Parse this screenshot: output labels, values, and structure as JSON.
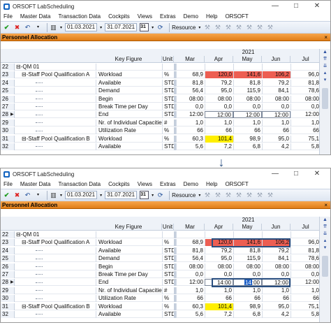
{
  "window": {
    "title": "ORSOFT LabScheduling",
    "controls": [
      "—",
      "□",
      "✕"
    ]
  },
  "menu": [
    "File",
    "Master Data",
    "Transaction Data",
    "Cockpits",
    "Views",
    "Extras",
    "Demo",
    "Help",
    "ORSOFT"
  ],
  "toolbar": {
    "date_from": "01.03.2021",
    "date_to": "31.07.2021",
    "calendar_label": "31",
    "dropdown_label": "Resource"
  },
  "panel": {
    "title": "Personnel Allocation",
    "close": "×"
  },
  "grid": {
    "year": "2021",
    "col_key_figure": "Key Figure",
    "col_unit": "Unit",
    "months": [
      "Mar",
      "Apr",
      "May",
      "Jun",
      "Jul"
    ],
    "rows_before": [
      {
        "n": "22",
        "tree": "⊟-QM 01",
        "kf": "",
        "unit": "",
        "vals": [
          "",
          "",
          "",
          "",
          ""
        ]
      },
      {
        "n": "23",
        "tree": "⊟-Staff Pool Qualification A",
        "kf": "Workload",
        "unit": "%",
        "vals": [
          "68,9",
          "120,0",
          "141,6",
          "106,2",
          "96,0"
        ]
      },
      {
        "n": "24",
        "tree": "",
        "kf": "Available",
        "unit": "STD",
        "vals": [
          "81,8",
          "79,2",
          "81,8",
          "79,2",
          "81,8"
        ]
      },
      {
        "n": "25",
        "tree": "",
        "kf": "Demand",
        "unit": "STD",
        "vals": [
          "56,4",
          "95,0",
          "115,9",
          "84,1",
          "78,6"
        ]
      },
      {
        "n": "26",
        "tree": "",
        "kf": "Begin",
        "unit": "STD",
        "vals": [
          "08:00",
          "08:00",
          "08:00",
          "08:00",
          "08:00"
        ]
      },
      {
        "n": "27",
        "tree": "",
        "kf": "Break Time per Day",
        "unit": "STD",
        "vals": [
          "0,0",
          "0,0",
          "0,0",
          "0,0",
          "0,0"
        ]
      },
      {
        "n": "28",
        "tree": "",
        "kf": "End",
        "unit": "STD",
        "vals": [
          "12:00",
          "12:00",
          "12:00",
          "12:00",
          "12:00"
        ]
      },
      {
        "n": "29",
        "tree": "",
        "kf": "Nr. of Individual Capacities",
        "unit": "#",
        "vals": [
          "1,0",
          "1,0",
          "1,0",
          "1,0",
          "1,0"
        ]
      },
      {
        "n": "30",
        "tree": "",
        "kf": "Utilization Rate",
        "unit": "%",
        "vals": [
          "66",
          "66",
          "66",
          "66",
          "66"
        ]
      },
      {
        "n": "31",
        "tree": "⊟-Staff Pool Qualification B",
        "kf": "Workload",
        "unit": "%",
        "vals": [
          "60,3",
          "101,4",
          "98,9",
          "95,0",
          "75,1"
        ]
      },
      {
        "n": "32",
        "tree": "",
        "kf": "Available",
        "unit": "STD",
        "vals": [
          "5,6",
          "7,2",
          "6,8",
          "4,2",
          "5,8"
        ]
      }
    ],
    "rows_after": [
      {
        "n": "22",
        "tree": "⊟-QM 01",
        "kf": "",
        "unit": "",
        "vals": [
          "",
          "",
          "",
          "",
          ""
        ]
      },
      {
        "n": "23",
        "tree": "⊟-Staff Pool Qualification A",
        "kf": "Workload",
        "unit": "%",
        "vals": [
          "68,9",
          "120,0",
          "141,6",
          "106,2",
          "96,0"
        ]
      },
      {
        "n": "24",
        "tree": "",
        "kf": "Available",
        "unit": "STD",
        "vals": [
          "81,8",
          "79,2",
          "81,8",
          "79,2",
          "81,8"
        ]
      },
      {
        "n": "25",
        "tree": "",
        "kf": "Demand",
        "unit": "STD",
        "vals": [
          "56,4",
          "95,0",
          "115,9",
          "84,1",
          "78,6"
        ]
      },
      {
        "n": "26",
        "tree": "",
        "kf": "Begin",
        "unit": "STD",
        "vals": [
          "08:00",
          "08:00",
          "08:00",
          "08:00",
          "08:00"
        ]
      },
      {
        "n": "27",
        "tree": "",
        "kf": "Break Time per Day",
        "unit": "STD",
        "vals": [
          "0,0",
          "0,0",
          "0,0",
          "0,0",
          "0,0"
        ]
      },
      {
        "n": "28",
        "tree": "",
        "kf": "End",
        "unit": "STD",
        "vals": [
          "12:00",
          "14:00",
          "14:00",
          "12:00",
          "12:00"
        ]
      },
      {
        "n": "29",
        "tree": "",
        "kf": "Nr. of Individual Capacities",
        "unit": "#",
        "vals": [
          "1,0",
          "1,0",
          "1,0",
          "1,0",
          "1,0"
        ]
      },
      {
        "n": "30",
        "tree": "",
        "kf": "Utilization Rate",
        "unit": "%",
        "vals": [
          "66",
          "66",
          "66",
          "66",
          "66"
        ]
      },
      {
        "n": "31",
        "tree": "⊟-Staff Pool Qualification B",
        "kf": "Workload",
        "unit": "%",
        "vals": [
          "60,3",
          "101,4",
          "98,9",
          "95,0",
          "75,1"
        ]
      },
      {
        "n": "32",
        "tree": "",
        "kf": "Available",
        "unit": "STD",
        "vals": [
          "5,6",
          "7,2",
          "6,8",
          "4,2",
          "5,8"
        ]
      }
    ],
    "red_cells": [
      [
        1,
        1
      ],
      [
        1,
        2
      ],
      [
        1,
        3
      ]
    ],
    "yellow_cells": [
      [
        9,
        1
      ]
    ],
    "cursor_text": "14"
  },
  "colors": {
    "accent": "#e07d17",
    "red": "#ed5e52",
    "yellow": "#ffef00",
    "highlight": "#2a4f80"
  }
}
